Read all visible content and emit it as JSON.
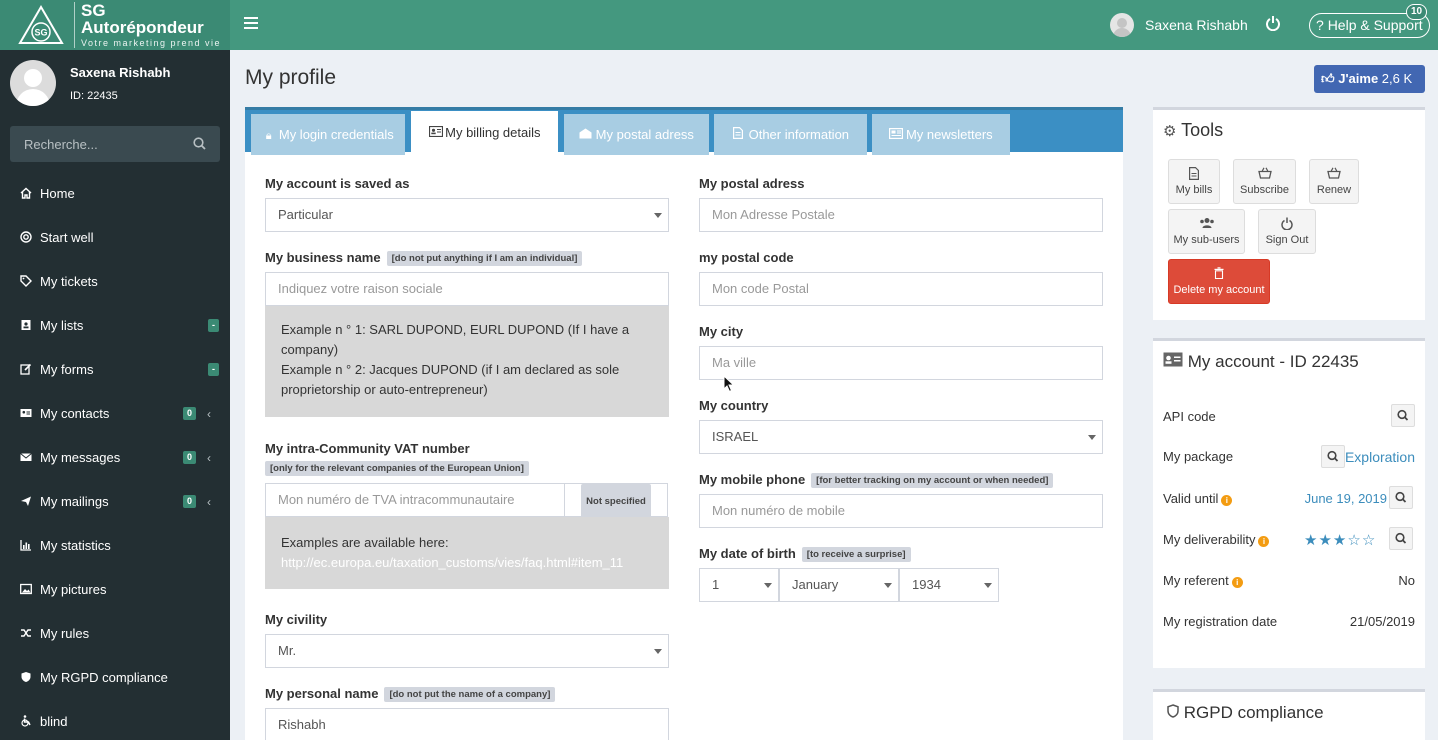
{
  "logo": {
    "name": "SG Autorépondeur",
    "tagline": "Votre marketing prend vie",
    "mark": "SG"
  },
  "header": {
    "user_name": "Saxena Rishabh",
    "help_label": "Help & Support",
    "help_badge": "10"
  },
  "sidebar": {
    "user_name": "Saxena Rishabh",
    "user_id": "ID: 22435",
    "search_placeholder": "Recherche...",
    "items": [
      {
        "label": "Home",
        "icon": "home-icon"
      },
      {
        "label": "Start well",
        "icon": "lifebuoy-icon"
      },
      {
        "label": "My tickets",
        "icon": "tag-icon"
      },
      {
        "label": "My lists",
        "icon": "address-book-icon",
        "badge": "-"
      },
      {
        "label": "My forms",
        "icon": "edit-icon",
        "badge": "-"
      },
      {
        "label": "My contacts",
        "icon": "id-card-icon",
        "badge": "0"
      },
      {
        "label": "My messages",
        "icon": "envelope-icon",
        "badge": "0"
      },
      {
        "label": "My mailings",
        "icon": "plane-icon",
        "badge": "0"
      },
      {
        "label": "My statistics",
        "icon": "bar-chart-icon"
      },
      {
        "label": "My pictures",
        "icon": "image-icon"
      },
      {
        "label": "My rules",
        "icon": "random-icon"
      },
      {
        "label": "My RGPD compliance",
        "icon": "shield-icon"
      },
      {
        "label": "blind",
        "icon": "wheelchair-icon"
      }
    ]
  },
  "main": {
    "title": "My profile",
    "like_label": "J'aime",
    "like_count": "2,6 K",
    "tabs": [
      {
        "label": "My login credentials",
        "icon": "lock-icon"
      },
      {
        "label": "My billing details",
        "icon": "id-card-icon"
      },
      {
        "label": "My postal adress",
        "icon": "envelope-open-icon"
      },
      {
        "label": "Other information",
        "icon": "file-text-icon"
      },
      {
        "label": "My newsletters",
        "icon": "newspaper-icon"
      }
    ],
    "left": {
      "account_saved_label": "My account is saved as",
      "account_saved_value": "Particular",
      "business_label": "My business name",
      "business_hint": "[do not put anything if I am an individual]",
      "business_placeholder": "Indiquez votre raison sociale",
      "business_note_1": "Example n ° 1: SARL DUPOND, EURL DUPOND (If I have a company)",
      "business_note_2": "Example n ° 2: Jacques DUPOND (if I am declared as sole proprietorship or auto-entrepreneur)",
      "vat_label": "My intra-Community VAT number",
      "vat_hint": "[only for the relevant companies of the European Union]",
      "vat_placeholder": "Mon numéro de TVA intracommunautaire",
      "vat_status": "Not specified",
      "vat_note_title": "Examples are available here:",
      "vat_note_link": "http://ec.europa.eu/taxation_customs/vies/faq.html#item_11",
      "civility_label": "My civility",
      "civility_value": "Mr.",
      "personal_label": "My personal name",
      "personal_hint": "[do not put the name of a company]",
      "personal_value": "Rishabh"
    },
    "right": {
      "postal_label": "My postal adress",
      "postal_placeholder": "Mon Adresse Postale",
      "postcode_label": "my postal code",
      "postcode_placeholder": "Mon code Postal",
      "city_label": "My city",
      "city_placeholder": "Ma ville",
      "country_label": "My country",
      "country_value": "ISRAEL",
      "mobile_label": "My mobile phone",
      "mobile_hint": "[for better tracking on my account or when needed]",
      "mobile_placeholder": "Mon numéro de mobile",
      "dob_label": "My date of birth",
      "dob_hint": "[to receive a surprise]",
      "dob_day": "1",
      "dob_month": "January",
      "dob_year": "1934"
    }
  },
  "tools": {
    "title": "Tools",
    "buttons": {
      "bills": "My bills",
      "subscribe": "Subscribe",
      "renew": "Renew",
      "subusers": "My sub-users",
      "signout": "Sign Out",
      "delete": "Delete my account"
    }
  },
  "account": {
    "title": "My account - ID 22435",
    "api_label": "API code",
    "package_label": "My package",
    "package_value": "Exploration",
    "valid_label": "Valid until",
    "valid_value": "June 19, 2019",
    "deliverability_label": "My deliverability",
    "deliverability_stars": 3,
    "deliverability_max": 5,
    "referent_label": "My referent",
    "referent_value": "No",
    "registration_label": "My registration date",
    "registration_value": "21/05/2019"
  },
  "rgpd": {
    "title": "RGPD compliance"
  },
  "colors": {
    "header": "#44987f",
    "sidebar": "#232f33",
    "tabs": "#3b8fc4",
    "facebook": "#4267b2",
    "delete": "#dd4b39",
    "link": "#3c8dbc"
  }
}
